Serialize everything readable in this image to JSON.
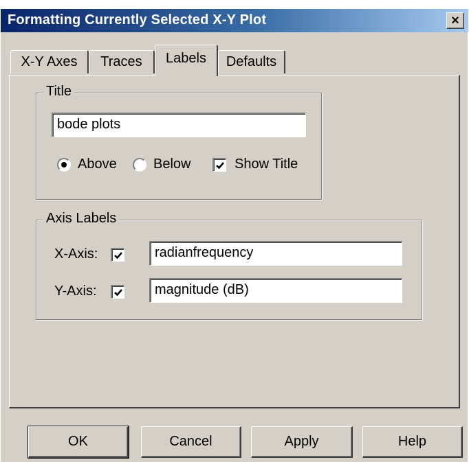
{
  "window": {
    "title": "Formatting Currently Selected X-Y Plot",
    "close_glyph": "×"
  },
  "tabs": [
    {
      "label": "X-Y Axes",
      "active": false
    },
    {
      "label": "Traces",
      "active": false
    },
    {
      "label": "Labels",
      "active": true
    },
    {
      "label": "Defaults",
      "active": false
    }
  ],
  "title_group": {
    "label": "Title",
    "title_value": "bode plots",
    "above_label": "Above",
    "above_selected": true,
    "below_label": "Below",
    "below_selected": false,
    "show_title_label": "Show Title",
    "show_title_checked": true
  },
  "axis_group": {
    "label": "Axis Labels",
    "x_label": "X-Axis:",
    "x_checked": true,
    "x_value": "radianfrequency",
    "y_label": "Y-Axis:",
    "y_checked": true,
    "y_value": "magnitude (dB)"
  },
  "buttons": {
    "ok": "OK",
    "cancel": "Cancel",
    "apply": "Apply",
    "help": "Help"
  },
  "colors": {
    "titlebar_start": "#0a246a",
    "titlebar_end": "#a6caf0",
    "face": "#d4d0c8"
  },
  "icons": {
    "close": "close-icon",
    "check": "checkmark-icon"
  }
}
